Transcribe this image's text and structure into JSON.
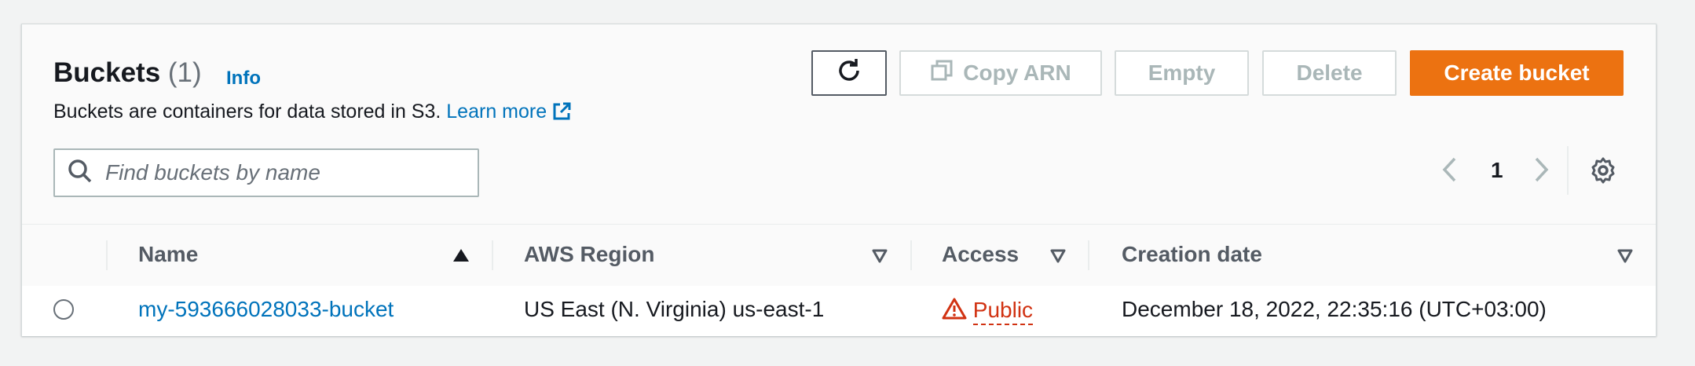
{
  "header": {
    "title": "Buckets",
    "count": "(1)",
    "info_label": "Info",
    "description": "Buckets are containers for data stored in S3.",
    "learn_more": "Learn more"
  },
  "toolbar": {
    "refresh_icon": "refresh-icon",
    "copy_arn_label": "Copy ARN",
    "empty_label": "Empty",
    "delete_label": "Delete",
    "create_label": "Create bucket"
  },
  "search": {
    "placeholder": "Find buckets by name",
    "value": ""
  },
  "pagination": {
    "current_page": "1"
  },
  "table": {
    "columns": [
      "Name",
      "AWS Region",
      "Access",
      "Creation date"
    ],
    "rows": [
      {
        "name": "my-593666028033-bucket",
        "region": "US East (N. Virginia) us-east-1",
        "access": "Public",
        "created": "December 18, 2022, 22:35:16 (UTC+03:00)"
      }
    ]
  },
  "colors": {
    "link": "#0073bb",
    "primary": "#ec7211",
    "warning": "#d13212"
  }
}
